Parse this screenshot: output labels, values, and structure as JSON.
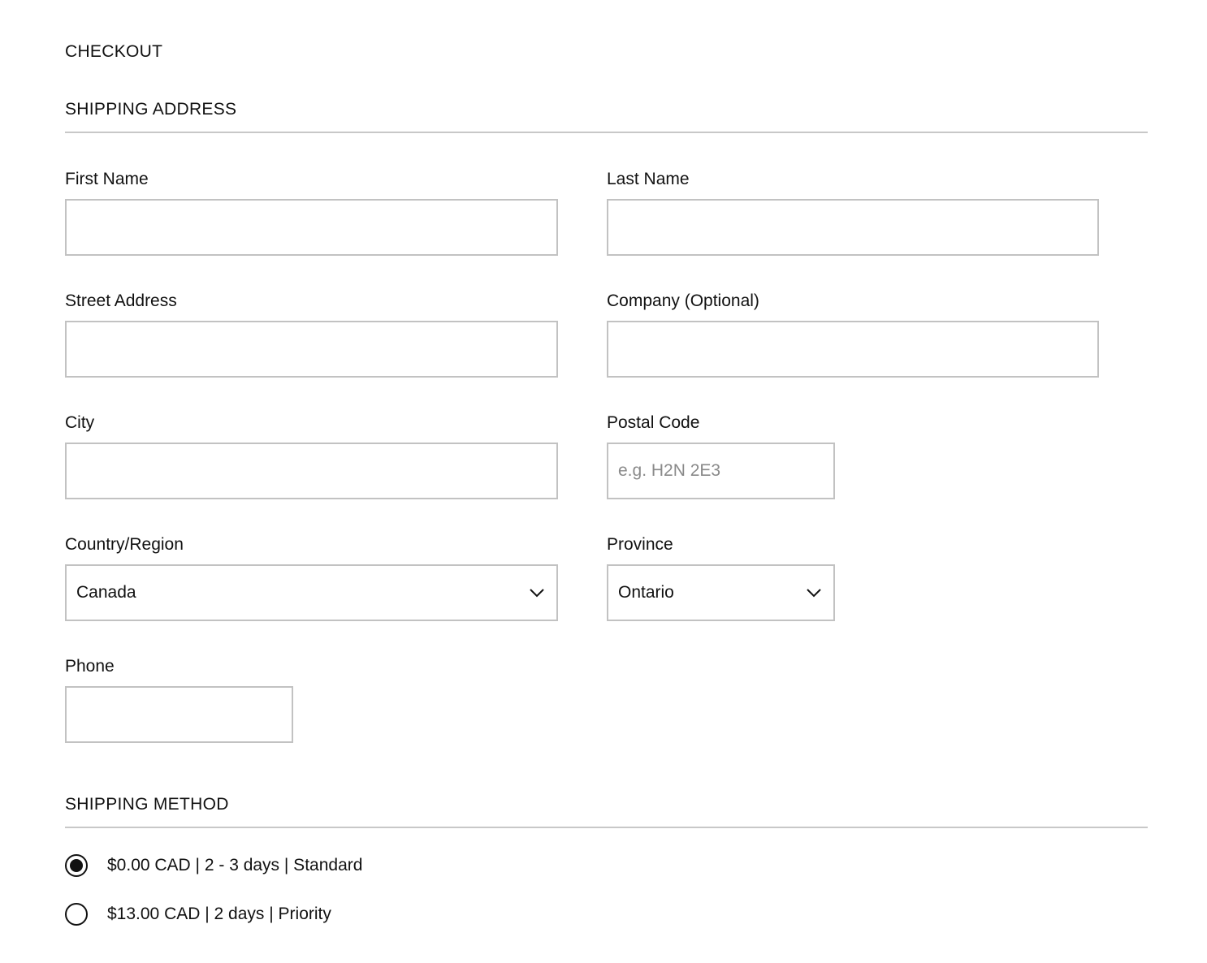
{
  "page": {
    "title": "CHECKOUT"
  },
  "shipping_address": {
    "heading": "SHIPPING ADDRESS",
    "fields": {
      "first_name": {
        "label": "First Name",
        "value": "",
        "placeholder": ""
      },
      "last_name": {
        "label": "Last Name",
        "value": "",
        "placeholder": ""
      },
      "street_address": {
        "label": "Street Address",
        "value": "",
        "placeholder": ""
      },
      "company": {
        "label": "Company (Optional)",
        "value": "",
        "placeholder": ""
      },
      "city": {
        "label": "City",
        "value": "",
        "placeholder": ""
      },
      "postal_code": {
        "label": "Postal Code",
        "value": "",
        "placeholder": "e.g. H2N 2E3"
      },
      "country": {
        "label": "Country/Region",
        "selected": "Canada"
      },
      "province": {
        "label": "Province",
        "selected": "Ontario"
      },
      "phone": {
        "label": "Phone",
        "value": "",
        "placeholder": ""
      }
    }
  },
  "shipping_method": {
    "heading": "SHIPPING METHOD",
    "options": [
      {
        "label": "$0.00 CAD | 2 - 3 days | Standard",
        "selected": true
      },
      {
        "label": "$13.00 CAD | 2 days | Priority",
        "selected": false
      }
    ]
  },
  "icons": {
    "select_chevron": "chevron-down-icon"
  },
  "colors": {
    "text": "#111111",
    "border": "#c2c2c2",
    "divider": "#c8c8c8",
    "placeholder": "#8a8a8a"
  }
}
